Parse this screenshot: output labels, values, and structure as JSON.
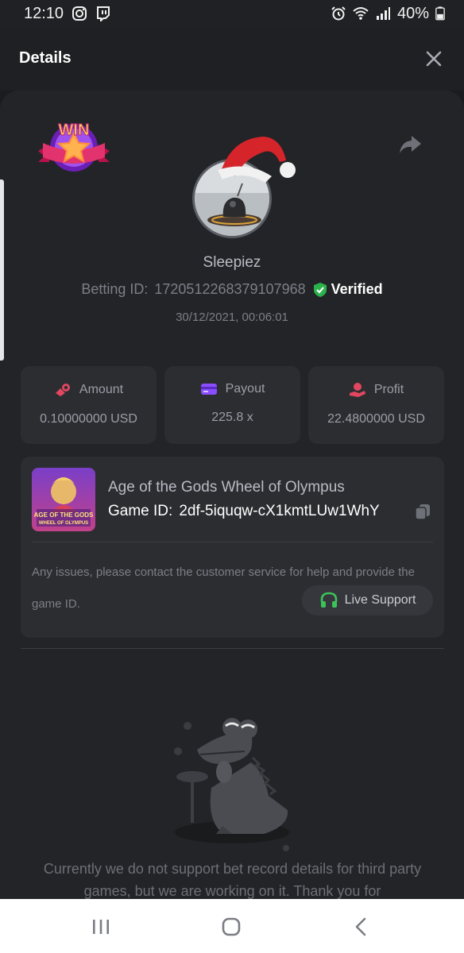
{
  "status_bar": {
    "time": "12:10",
    "battery": "40%"
  },
  "header": {
    "title": "Details"
  },
  "bet": {
    "username": "Sleepiez",
    "betting_id_label": "Betting ID:",
    "betting_id": "1720512268379107968",
    "verified_label": "Verified",
    "datetime": "30/12/2021, 00:06:01",
    "win_badge_text": "WIN"
  },
  "stats": [
    {
      "label": "Amount",
      "value": "0.10000000 USD",
      "icon": "coins-icon"
    },
    {
      "label": "Payout",
      "value": "225.8 x",
      "icon": "card-icon"
    },
    {
      "label": "Profit",
      "value": "22.4800000 USD",
      "icon": "hand-coin-icon"
    }
  ],
  "game": {
    "title": "Age of the Gods Wheel of Olympus",
    "id_label": "Game ID:",
    "id_value": "2df-5iquqw-cX1kmtLUw1WhY",
    "thumb_line1": "AGE OF THE GODS",
    "thumb_line2": "WHEEL OF OLYMPUS",
    "support_text": "Any issues, please contact the customer service for help and provide the game ID.",
    "live_support_label": "Live Support"
  },
  "notice": {
    "text": "Currently we do not support bet record details for third party games, but we are working on it. Thank you for"
  },
  "colors": {
    "background": "#1b1c1f",
    "card": "#2c2d31",
    "verified_green": "#2bb24c",
    "amount_icon": "#e2475f",
    "payout_icon": "#8a4dff",
    "profit_icon": "#e2475f",
    "support_green": "#3cc25a"
  }
}
